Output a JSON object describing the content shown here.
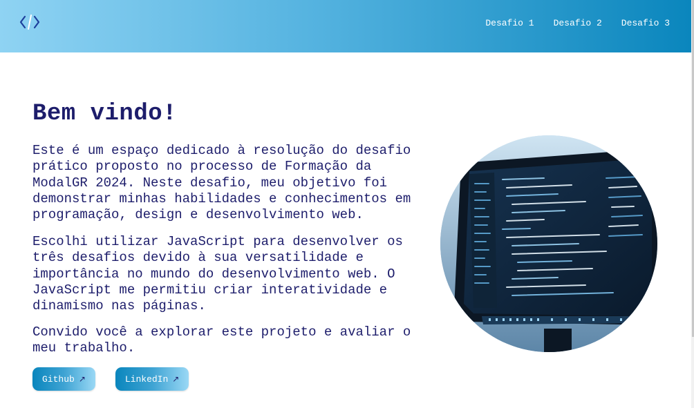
{
  "header": {
    "logo_icon": "code-icon",
    "nav": [
      {
        "label": "Desafio 1"
      },
      {
        "label": "Desafio 2"
      },
      {
        "label": "Desafio 3"
      }
    ]
  },
  "main": {
    "title": "Bem vindo!",
    "paragraphs": [
      "Este é um espaço dedicado à resolução do desafio prático proposto no processo de Formação da ModalGR 2024. Neste desafio, meu objetivo foi demonstrar minhas habilidades e conhecimentos em programação, design e desenvolvimento web.",
      "Escolhi utilizar JavaScript para desenvolver os três desafios devido à sua versatilidade e importância no mundo do desenvolvimento web. O JavaScript me permitiu criar interatividade e dinamismo nas páginas.",
      "Convido você a explorar este projeto e avaliar o meu trabalho."
    ],
    "buttons": [
      {
        "label": "Github",
        "icon": "arrow-up-right-icon"
      },
      {
        "label": "LinkedIn",
        "icon": "arrow-up-right-icon"
      }
    ],
    "hero_image": "code-editor-monitor-image"
  },
  "colors": {
    "header_start": "#8fd3f3",
    "header_end": "#0a86bd",
    "text": "#1d1d6b",
    "button_start": "#0a86bd",
    "button_end": "#9ad8f5"
  }
}
